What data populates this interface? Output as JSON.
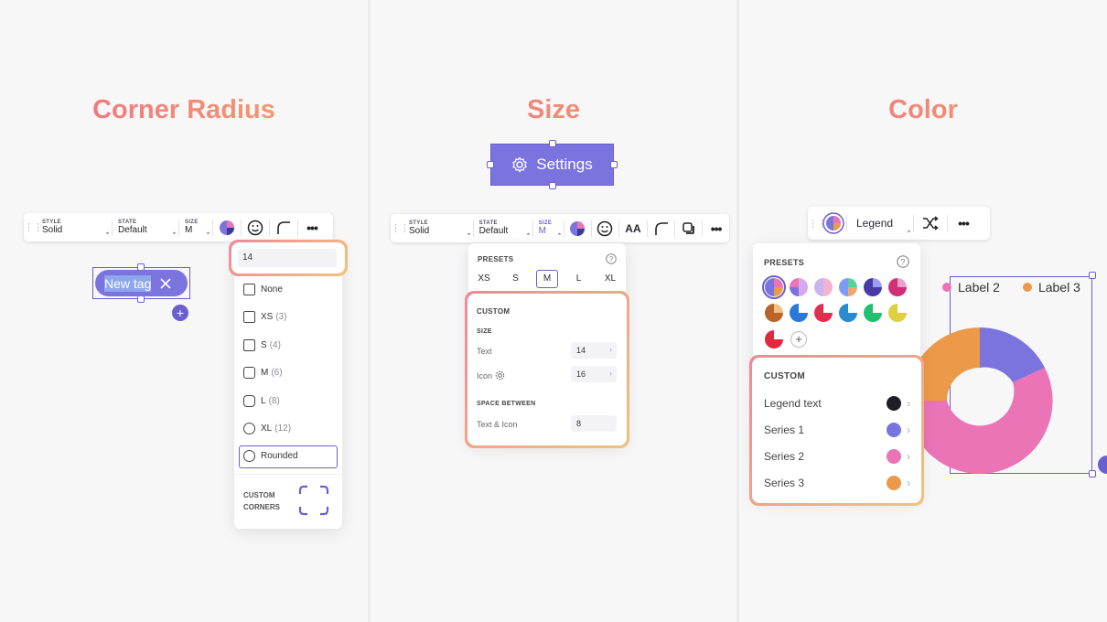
{
  "panels": {
    "corner": {
      "title": "Corner Radius",
      "toolbar": {
        "style_label": "STYLE",
        "style_value": "Solid",
        "state_label": "STATE",
        "state_value": "Default",
        "size_label": "SIZE",
        "size_value": "M"
      },
      "tag": {
        "label": "New tag"
      },
      "dropdown": {
        "input_value": "14",
        "options": [
          {
            "label": "None",
            "hint": ""
          },
          {
            "label": "XS",
            "hint": "(3)"
          },
          {
            "label": "S",
            "hint": "(4)"
          },
          {
            "label": "M",
            "hint": "(6)"
          },
          {
            "label": "L",
            "hint": "(8)"
          },
          {
            "label": "XL",
            "hint": "(12)"
          },
          {
            "label": "Rounded",
            "hint": ""
          }
        ],
        "custom_line1": "CUSTOM",
        "custom_line2": "CORNERS"
      }
    },
    "size": {
      "title": "Size",
      "button_label": "Settings",
      "toolbar": {
        "style_label": "STYLE",
        "style_value": "Solid",
        "state_label": "STATE",
        "state_value": "Default",
        "size_label": "SIZE",
        "size_value": "M",
        "aa_label": "AA"
      },
      "presets": {
        "label": "PRESETS",
        "items": [
          "XS",
          "S",
          "M",
          "L",
          "XL"
        ],
        "selected": "M"
      },
      "custom": {
        "label": "CUSTOM",
        "size_label": "SIZE",
        "text_label": "Text",
        "text_value": "14",
        "icon_label": "Icon",
        "icon_value": "16",
        "space_label": "SPACE BETWEEN",
        "space_text_label": "Text & Icon",
        "space_value": "8"
      }
    },
    "color": {
      "title": "Color",
      "toolbar": {
        "legend_label": "Legend"
      },
      "presets_label": "PRESETS",
      "custom": {
        "label": "CUSTOM",
        "rows": [
          {
            "label": "Legend text",
            "color": "#1e1e24"
          },
          {
            "label": "Series 1",
            "color": "#7b74de"
          },
          {
            "label": "Series 2",
            "color": "#ea74b6"
          },
          {
            "label": "Series 3",
            "color": "#ec9a4a"
          }
        ]
      },
      "legend": [
        {
          "label": "Label 2",
          "color": "#ea74b6"
        },
        {
          "label": "Label 3",
          "color": "#ec9a4a"
        }
      ]
    }
  },
  "colors": {
    "accent": "#6b5fcf",
    "accent_light": "#7b74de",
    "pink": "#ea74b6",
    "orange": "#ec9a4a"
  }
}
